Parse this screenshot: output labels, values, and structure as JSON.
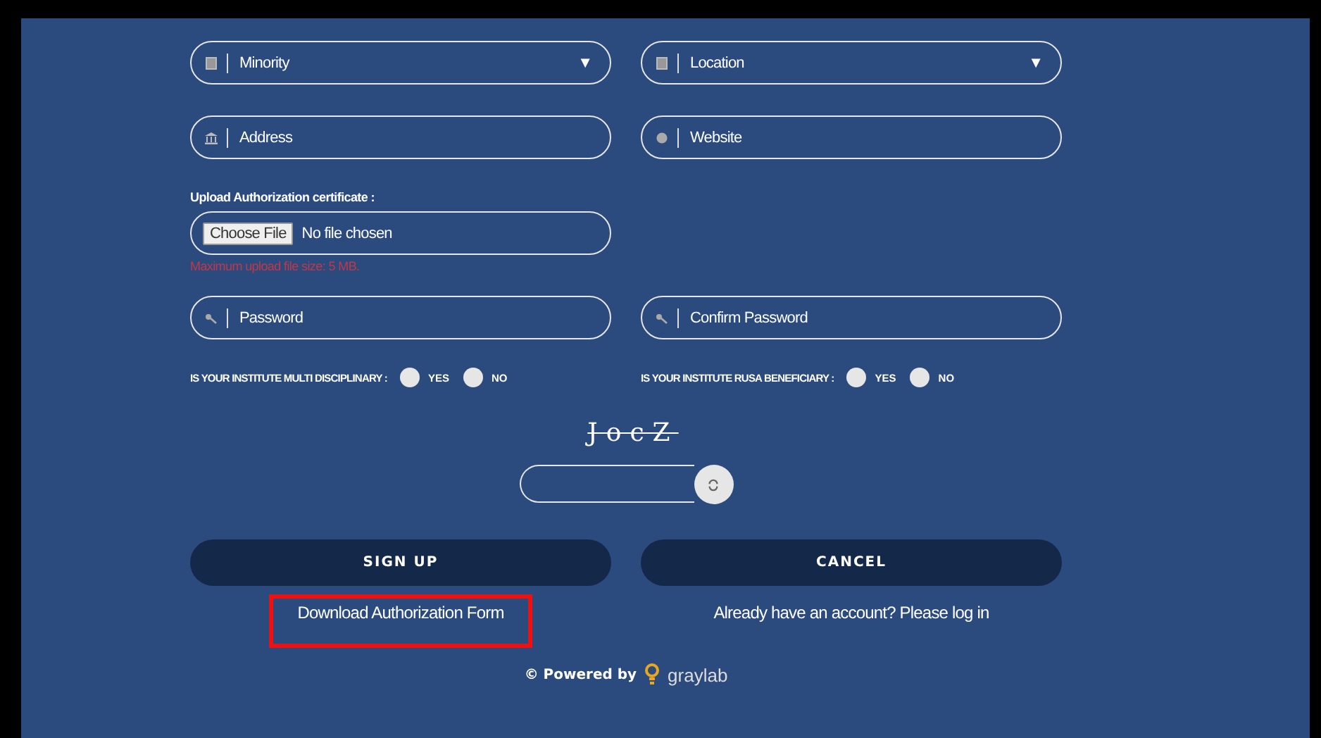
{
  "fields_row_1": [
    {
      "kind": "select",
      "placeholder": "Minority",
      "caret": "▼"
    },
    {
      "kind": "select",
      "placeholder": "Location",
      "caret": "▼"
    }
  ],
  "fields_row_2": [
    {
      "kind": "address",
      "placeholder": "Address"
    },
    {
      "kind": "website",
      "placeholder": "Website"
    }
  ],
  "upload": {
    "label": "Upload Authorization certificate :",
    "button": "Choose File",
    "status": "No file chosen",
    "hint": "Maximum upload file size: 5 MB."
  },
  "password_fields": [
    {
      "kind": "password",
      "placeholder": "Password"
    },
    {
      "kind": "password",
      "placeholder": "Confirm Password"
    }
  ],
  "questions": [
    {
      "label": "IS YOUR INSTITUTE MULTI DISCIPLINARY :",
      "options": [
        {
          "label": "YES",
          "selected": false
        },
        {
          "label": "NO",
          "selected": false
        }
      ]
    },
    {
      "label": "IS YOUR INSTITUTE RUSA BENEFICIARY :",
      "options": [
        {
          "label": "YES",
          "selected": false
        },
        {
          "label": "NO",
          "selected": false
        }
      ]
    }
  ],
  "captcha": {
    "text": "JocZ"
  },
  "buttons": [
    "SIGN UP",
    "CANCEL"
  ],
  "links": [
    {
      "label": "Download Authorization Form",
      "highlighted": true
    },
    {
      "label": "Already have an account? Please log in",
      "highlighted": false
    }
  ],
  "footer": {
    "text": "© Powered by",
    "brand": "graylab"
  }
}
